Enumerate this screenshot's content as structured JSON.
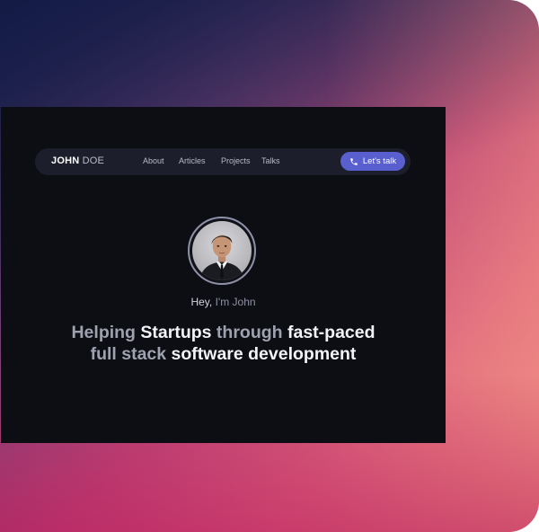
{
  "nav": {
    "brand_first": "JOHN",
    "brand_last": "DOE",
    "links": [
      "About",
      "Articles",
      "Projects",
      "Talks"
    ],
    "cta_label": "Let's talk"
  },
  "hero": {
    "greeting_prefix": "Hey,",
    "greeting_rest": "I'm John",
    "headline_line1_a": "Helping ",
    "headline_line1_b": "Startups",
    "headline_line1_c": " through ",
    "headline_line1_d": "fast-paced",
    "headline_line2_a": "full stack ",
    "headline_line2_b": "software development"
  },
  "colors": {
    "accent": "#5a5fd0",
    "window_bg": "#0d0e14",
    "navbar_bg": "#1d1e2b"
  }
}
